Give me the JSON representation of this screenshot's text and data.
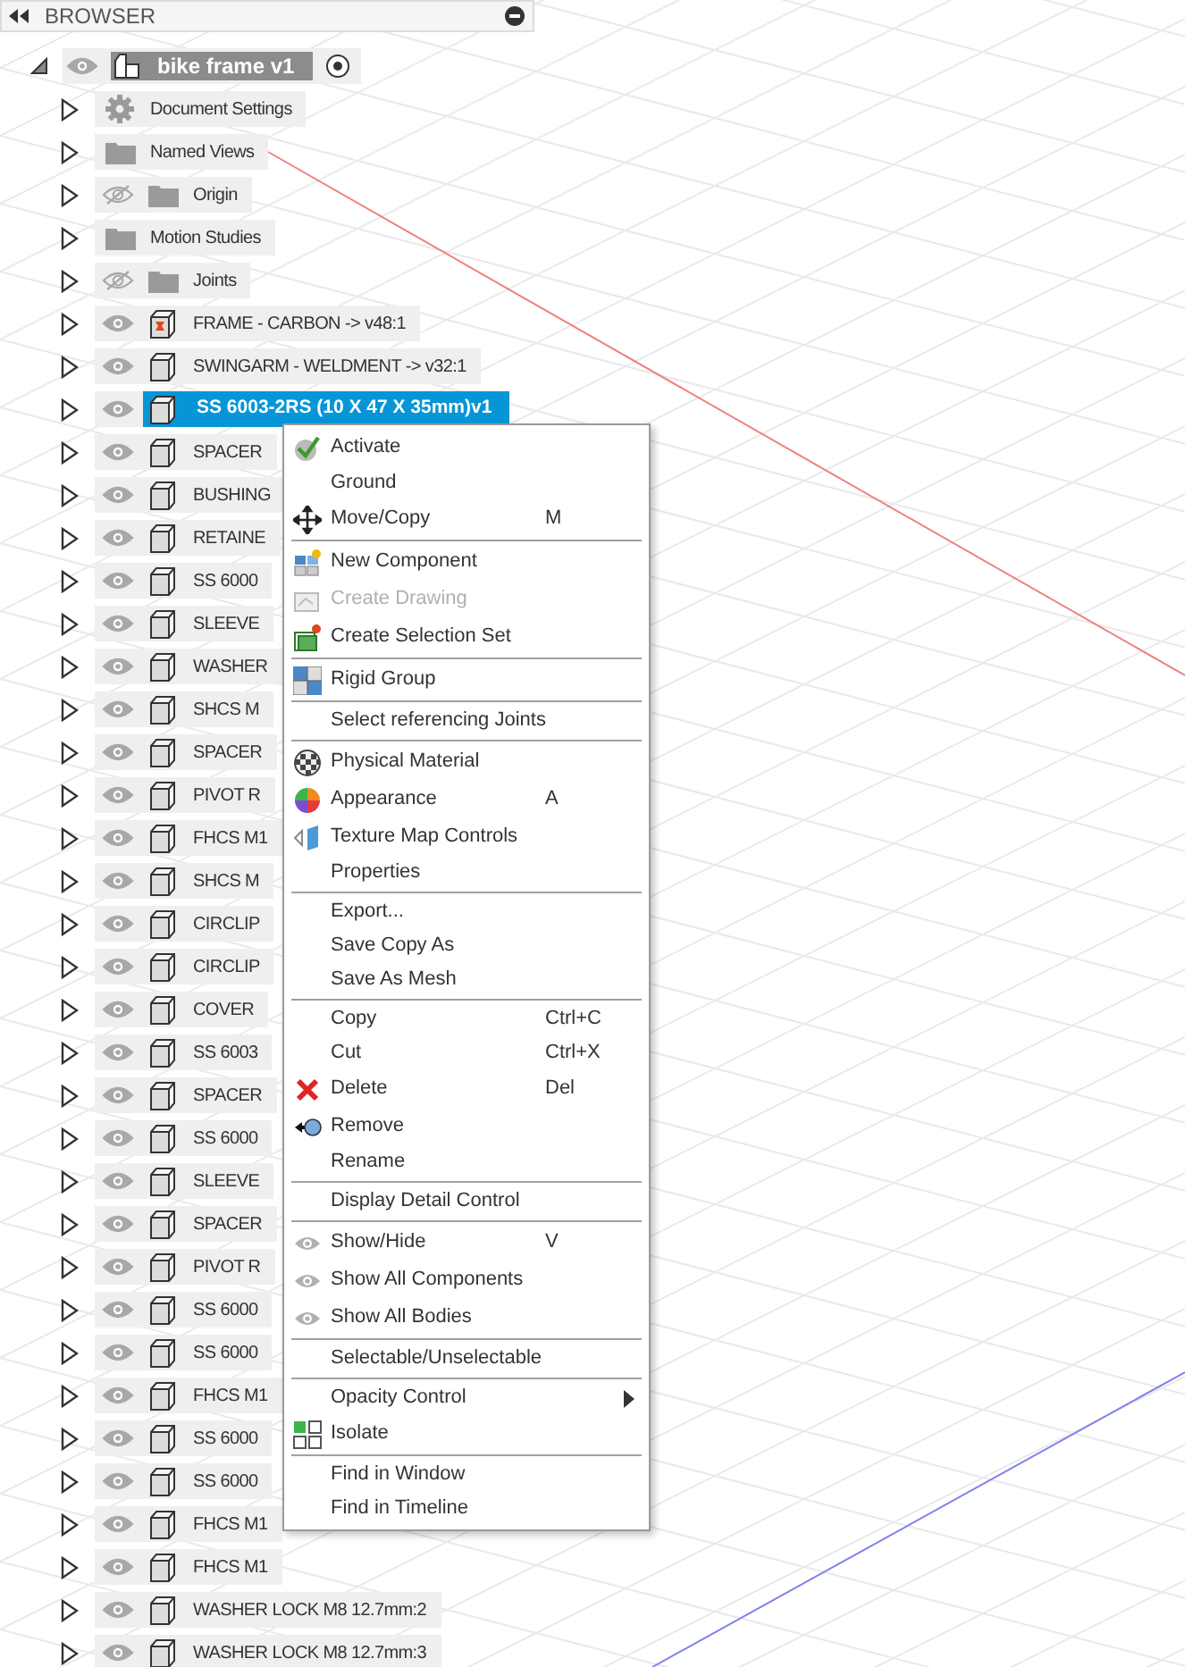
{
  "panel": {
    "title": "BROWSER"
  },
  "root": {
    "label": "bike frame v1",
    "expanded": true,
    "visible": true
  },
  "items": [
    {
      "kind": "settings",
      "label": "Document Settings",
      "expanded": false,
      "selected": false
    },
    {
      "kind": "folder",
      "label": "Named Views",
      "expanded": false,
      "selected": false
    },
    {
      "kind": "folder",
      "label": "Origin",
      "expanded": false,
      "selected": false,
      "visible": false
    },
    {
      "kind": "folder",
      "label": "Motion Studies",
      "expanded": false,
      "selected": false
    },
    {
      "kind": "folder",
      "label": "Joints",
      "expanded": false,
      "selected": false,
      "visible": false
    },
    {
      "kind": "linked",
      "label": "FRAME - CARBON -> v48:1",
      "expanded": false,
      "selected": false,
      "visible": true
    },
    {
      "kind": "component",
      "label": "SWINGARM - WELDMENT -> v32:1",
      "expanded": false,
      "selected": false,
      "visible": true
    },
    {
      "kind": "component",
      "label": "SS 6003-2RS (10 X 47 X 35mm)v1",
      "expanded": false,
      "selected": true,
      "visible": true
    },
    {
      "kind": "component",
      "label": "SPACER",
      "expanded": false,
      "selected": false,
      "visible": true
    },
    {
      "kind": "component",
      "label": "BUSHING",
      "expanded": false,
      "selected": false,
      "visible": true
    },
    {
      "kind": "component",
      "label": "RETAINE",
      "expanded": false,
      "selected": false,
      "visible": true
    },
    {
      "kind": "component",
      "label": "SS 6000",
      "expanded": false,
      "selected": false,
      "visible": true
    },
    {
      "kind": "component",
      "label": "SLEEVE",
      "expanded": false,
      "selected": false,
      "visible": true
    },
    {
      "kind": "component",
      "label": "WASHER",
      "expanded": false,
      "selected": false,
      "visible": true
    },
    {
      "kind": "component",
      "label": "SHCS M",
      "expanded": false,
      "selected": false,
      "visible": true
    },
    {
      "kind": "component",
      "label": "SPACER",
      "expanded": false,
      "selected": false,
      "visible": true
    },
    {
      "kind": "component",
      "label": "PIVOT R",
      "expanded": false,
      "selected": false,
      "visible": true
    },
    {
      "kind": "component",
      "label": "FHCS M1",
      "expanded": false,
      "selected": false,
      "visible": true
    },
    {
      "kind": "component",
      "label": "SHCS M",
      "expanded": false,
      "selected": false,
      "visible": true
    },
    {
      "kind": "component",
      "label": "CIRCLIP",
      "expanded": false,
      "selected": false,
      "visible": true
    },
    {
      "kind": "component",
      "label": "CIRCLIP",
      "expanded": false,
      "selected": false,
      "visible": true
    },
    {
      "kind": "component",
      "label": "COVER",
      "expanded": false,
      "selected": false,
      "visible": true
    },
    {
      "kind": "component",
      "label": "SS 6003",
      "expanded": false,
      "selected": false,
      "visible": true
    },
    {
      "kind": "component",
      "label": "SPACER",
      "expanded": false,
      "selected": false,
      "visible": true
    },
    {
      "kind": "component",
      "label": "SS 6000",
      "expanded": false,
      "selected": false,
      "visible": true
    },
    {
      "kind": "component",
      "label": "SLEEVE",
      "expanded": false,
      "selected": false,
      "visible": true
    },
    {
      "kind": "component",
      "label": "SPACER",
      "expanded": false,
      "selected": false,
      "visible": true
    },
    {
      "kind": "component",
      "label": "PIVOT R",
      "expanded": false,
      "selected": false,
      "visible": true
    },
    {
      "kind": "component",
      "label": "SS 6000",
      "expanded": false,
      "selected": false,
      "visible": true
    },
    {
      "kind": "component",
      "label": "SS 6000",
      "expanded": false,
      "selected": false,
      "visible": true
    },
    {
      "kind": "component",
      "label": "FHCS M1",
      "expanded": false,
      "selected": false,
      "visible": true
    },
    {
      "kind": "component",
      "label": "SS 6000",
      "expanded": false,
      "selected": false,
      "visible": true
    },
    {
      "kind": "component",
      "label": "SS 6000",
      "expanded": false,
      "selected": false,
      "visible": true
    },
    {
      "kind": "component",
      "label": "FHCS M1",
      "expanded": false,
      "selected": false,
      "visible": true
    },
    {
      "kind": "component",
      "label": "FHCS M1",
      "expanded": false,
      "selected": false,
      "visible": true
    },
    {
      "kind": "component",
      "label": "WASHER LOCK M8 12.7mm:2",
      "expanded": false,
      "selected": false,
      "visible": true
    },
    {
      "kind": "component",
      "label": "WASHER LOCK M8 12.7mm:3",
      "expanded": false,
      "selected": false,
      "visible": true
    }
  ],
  "context_menu": {
    "groups": [
      [
        {
          "kind": "activate",
          "label": "Activate",
          "disabled": false,
          "submenu": false
        },
        {
          "kind": "plain",
          "label": "Ground",
          "disabled": false,
          "submenu": false
        },
        {
          "kind": "move",
          "label": "Move/Copy",
          "shortcut": "M",
          "disabled": false,
          "submenu": false
        }
      ],
      [
        {
          "kind": "new-component",
          "label": "New Component",
          "disabled": false,
          "submenu": false
        },
        {
          "kind": "drawing",
          "label": "Create Drawing",
          "disabled": true,
          "submenu": false
        },
        {
          "kind": "selection-set",
          "label": "Create Selection Set",
          "disabled": false,
          "submenu": false
        }
      ],
      [
        {
          "kind": "rigid-group",
          "label": "Rigid Group",
          "disabled": false,
          "submenu": false
        }
      ],
      [
        {
          "kind": "plain",
          "label": "Select referencing Joints",
          "disabled": false,
          "submenu": false
        }
      ],
      [
        {
          "kind": "material",
          "label": "Physical Material",
          "disabled": false,
          "submenu": false
        },
        {
          "kind": "appearance",
          "label": "Appearance",
          "shortcut": "A",
          "disabled": false,
          "submenu": false
        },
        {
          "kind": "texture",
          "label": "Texture Map Controls",
          "disabled": false,
          "submenu": false
        },
        {
          "kind": "plain",
          "label": "Properties",
          "disabled": false,
          "submenu": false
        }
      ],
      [
        {
          "kind": "plain",
          "label": "Export...",
          "disabled": false,
          "submenu": false
        },
        {
          "kind": "plain",
          "label": "Save Copy As",
          "disabled": false,
          "submenu": false
        },
        {
          "kind": "plain",
          "label": "Save As Mesh",
          "disabled": false,
          "submenu": false
        }
      ],
      [
        {
          "kind": "plain",
          "label": "Copy",
          "shortcut": "Ctrl+C",
          "disabled": false,
          "submenu": false
        },
        {
          "kind": "plain",
          "label": "Cut",
          "shortcut": "Ctrl+X",
          "disabled": false,
          "submenu": false
        },
        {
          "kind": "delete",
          "label": "Delete",
          "shortcut": "Del",
          "disabled": false,
          "submenu": false
        },
        {
          "kind": "remove",
          "label": "Remove",
          "disabled": false,
          "submenu": false
        },
        {
          "kind": "plain",
          "label": "Rename",
          "disabled": false,
          "submenu": false
        }
      ],
      [
        {
          "kind": "plain",
          "label": "Display Detail Control",
          "disabled": false,
          "submenu": false
        }
      ],
      [
        {
          "kind": "eye",
          "label": "Show/Hide",
          "shortcut": "V",
          "disabled": false,
          "submenu": false
        },
        {
          "kind": "eye",
          "label": "Show All Components",
          "disabled": false,
          "submenu": false
        },
        {
          "kind": "eye",
          "label": "Show All Bodies",
          "disabled": false,
          "submenu": false
        }
      ],
      [
        {
          "kind": "plain",
          "label": "Selectable/Unselectable",
          "disabled": false,
          "submenu": false
        }
      ],
      [
        {
          "kind": "plain",
          "label": "Opacity Control",
          "disabled": false,
          "submenu": true
        },
        {
          "kind": "isolate",
          "label": "Isolate",
          "disabled": false,
          "submenu": false
        }
      ],
      [
        {
          "kind": "plain",
          "label": "Find in Window",
          "disabled": false,
          "submenu": false
        },
        {
          "kind": "plain",
          "label": "Find in Timeline",
          "disabled": false,
          "submenu": false
        }
      ]
    ]
  }
}
